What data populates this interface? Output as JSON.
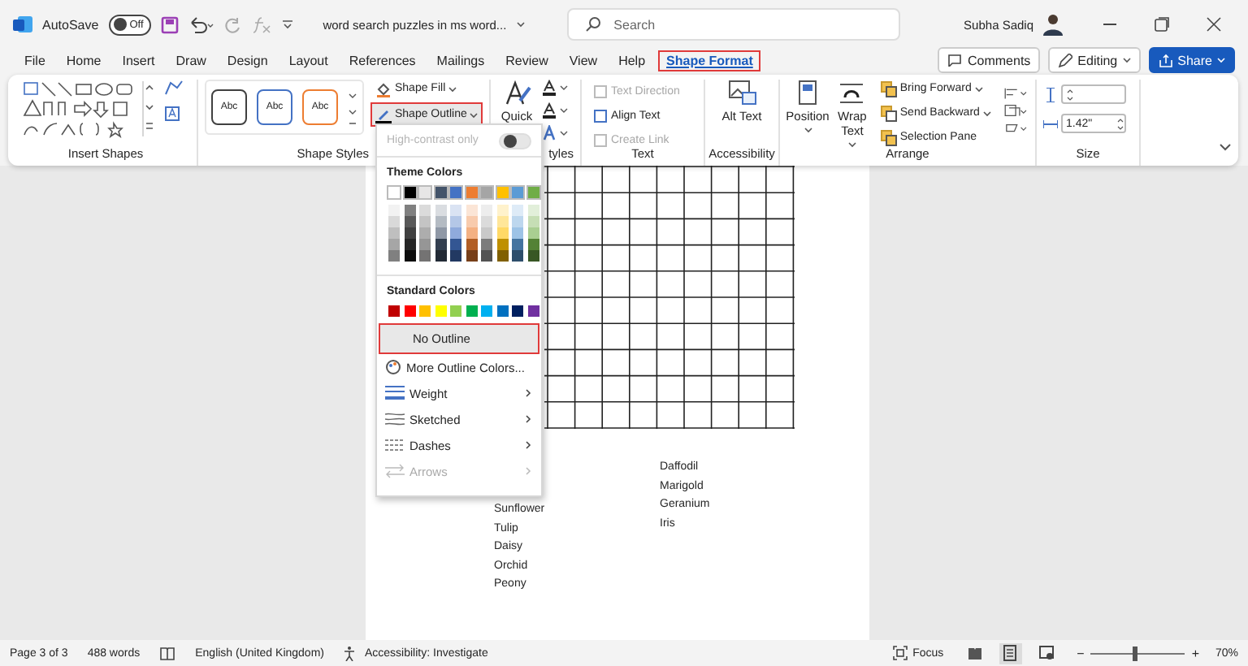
{
  "title_bar": {
    "autosave": {
      "label": "AutoSave",
      "on": false,
      "state": "Off"
    },
    "document_title": "word search puzzles in ms word...",
    "search": {
      "placeholder": "Search"
    },
    "user": "Subha Sadiq"
  },
  "tabs": [
    {
      "label": "File",
      "selected": false
    },
    {
      "label": "Home",
      "selected": false
    },
    {
      "label": "Insert",
      "selected": false
    },
    {
      "label": "Draw",
      "selected": false
    },
    {
      "label": "Design",
      "selected": false
    },
    {
      "label": "Layout",
      "selected": false
    },
    {
      "label": "References",
      "selected": false
    },
    {
      "label": "Mailings",
      "selected": false
    },
    {
      "label": "Review",
      "selected": false
    },
    {
      "label": "View",
      "selected": false
    },
    {
      "label": "Help",
      "selected": false
    },
    {
      "label": "Shape Format",
      "selected": true
    }
  ],
  "header_buttons": [
    {
      "kind": "comments",
      "label": "Comments"
    },
    {
      "kind": "editing",
      "label": "Editing"
    },
    {
      "kind": "share",
      "label": "Share"
    }
  ],
  "ribbon": {
    "groups": [
      {
        "kind": "shapes",
        "label": "Insert Shapes"
      },
      {
        "kind": "styles",
        "label": "Shape Styles",
        "thumbs": [
          {
            "label": "Abc",
            "color": "#404040"
          },
          {
            "label": "Abc",
            "color": "#4472c4"
          },
          {
            "label": "Abc",
            "color": "#ed7d31"
          }
        ],
        "fill": "Shape Fill",
        "outline": {
          "label": "Shape Outline",
          "highlighted": true
        }
      },
      {
        "kind": "wordart",
        "label": "tyles",
        "quick": "Quick"
      },
      {
        "kind": "stack",
        "label": "Text",
        "items": [
          {
            "label": "Text Direction",
            "disabled": true
          },
          {
            "label": "Align Text",
            "disabled": false
          },
          {
            "label": "Create Link",
            "disabled": true
          }
        ]
      },
      {
        "kind": "large",
        "label": "Accessibility",
        "buttons": [
          {
            "label": "Alt Text"
          }
        ]
      },
      {
        "kind": "arrange",
        "label": "Arrange",
        "buttons": [
          {
            "label": "Position"
          },
          {
            "label": "Wrap Text"
          }
        ],
        "items": [
          {
            "label": "Bring Forward"
          },
          {
            "label": "Send Backward"
          },
          {
            "label": "Selection Pane"
          }
        ]
      },
      {
        "kind": "size",
        "label": "Size",
        "fields": [
          {
            "kind": "height"
          },
          {
            "kind": "width",
            "value": "1.42\""
          }
        ]
      }
    ]
  },
  "outline_menu": {
    "high_contrast": {
      "label": "High-contrast only",
      "on": false,
      "disabled": true
    },
    "theme_heading": "Theme Colors",
    "theme_colors": [
      {
        "color": "#ffffff"
      },
      {
        "color": "#000000"
      },
      {
        "color": "#e7e6e6"
      },
      {
        "color": "#44546a"
      },
      {
        "color": "#4472c4"
      },
      {
        "color": "#ed7d31"
      },
      {
        "color": "#a5a5a5"
      },
      {
        "color": "#ffc000"
      },
      {
        "color": "#5b9bd5"
      },
      {
        "color": "#70ad47"
      }
    ],
    "standard_heading": "Standard Colors",
    "standard_colors": [
      {
        "color": "#c00000"
      },
      {
        "color": "#ff0000"
      },
      {
        "color": "#ffc000"
      },
      {
        "color": "#ffff00"
      },
      {
        "color": "#92d050"
      },
      {
        "color": "#00b050"
      },
      {
        "color": "#00b0f0"
      },
      {
        "color": "#0070c0"
      },
      {
        "color": "#002060"
      },
      {
        "color": "#7030a0"
      }
    ],
    "items": [
      {
        "kind": "none",
        "label": "No Outline",
        "highlighted": true,
        "disabled": false
      },
      {
        "kind": "palette",
        "label": "More Outline Colors...",
        "highlighted": false,
        "disabled": false
      },
      {
        "kind": "weight",
        "label": "Weight",
        "highlighted": false,
        "disabled": false
      },
      {
        "kind": "sketched",
        "label": "Sketched",
        "highlighted": false,
        "disabled": false
      },
      {
        "kind": "dashes",
        "label": "Dashes",
        "highlighted": false,
        "disabled": false
      },
      {
        "kind": "arrows",
        "label": "Arrows",
        "highlighted": false,
        "disabled": true
      }
    ]
  },
  "document": {
    "word_columns": [
      [
        "Sunflower",
        "Tulip",
        "Daisy",
        "Orchid",
        "Peony"
      ],
      [
        "Daffodil",
        "Marigold",
        "Geranium",
        "Iris"
      ]
    ]
  },
  "status_bar": {
    "page": "Page 3 of 3",
    "words": "488 words",
    "language": "English (United Kingdom)",
    "accessibility": "Accessibility: Investigate",
    "focus": "Focus",
    "views": [
      {
        "kind": "read",
        "selected": false
      },
      {
        "kind": "print",
        "selected": true
      },
      {
        "kind": "web",
        "selected": false
      }
    ],
    "zoom": {
      "minus": "−",
      "level": 0.47,
      "plus": "+",
      "label": "70%"
    }
  }
}
